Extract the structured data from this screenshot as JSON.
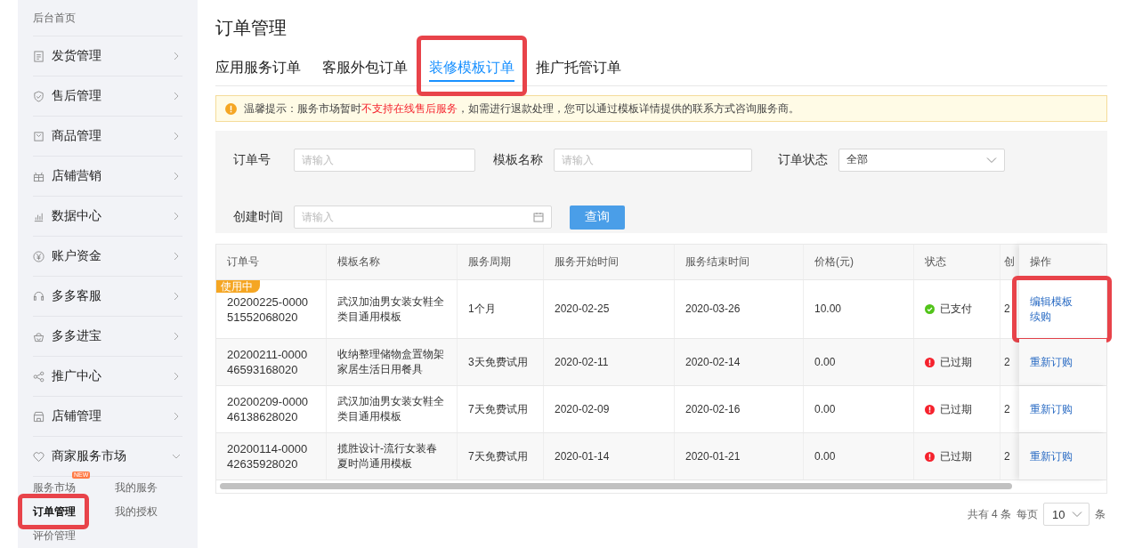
{
  "sidebar": {
    "home": "后台首页",
    "items": [
      {
        "label": "发货管理",
        "expanded": false
      },
      {
        "label": "售后管理",
        "expanded": false
      },
      {
        "label": "商品管理",
        "expanded": false
      },
      {
        "label": "店铺营销",
        "expanded": false
      },
      {
        "label": "数据中心",
        "expanded": false
      },
      {
        "label": "账户资金",
        "expanded": false
      },
      {
        "label": "多多客服",
        "expanded": false
      },
      {
        "label": "多多进宝",
        "expanded": false
      },
      {
        "label": "推广中心",
        "expanded": false
      },
      {
        "label": "店铺管理",
        "expanded": false
      },
      {
        "label": "商家服务市场",
        "expanded": true
      }
    ],
    "sub_items": [
      {
        "label": "服务市场",
        "badge": "NEW",
        "selected": false,
        "highlighted": false
      },
      {
        "label": "我的服务",
        "selected": false,
        "highlighted": false
      },
      {
        "label": "订单管理",
        "selected": true,
        "highlighted": true
      },
      {
        "label": "我的授权",
        "selected": false,
        "highlighted": false
      },
      {
        "label": "评价管理",
        "selected": false,
        "highlighted": false
      }
    ]
  },
  "page_title": "订单管理",
  "tabs": [
    {
      "label": "应用服务订单",
      "selected": false,
      "highlighted": false
    },
    {
      "label": "客服外包订单",
      "selected": false,
      "highlighted": false
    },
    {
      "label": "装修模板订单",
      "selected": true,
      "highlighted": true
    },
    {
      "label": "推广托管订单",
      "selected": false,
      "highlighted": false
    }
  ],
  "notice": {
    "text": "温馨提示：服务市场暂时**不支持在线售后服务**，如需进行退款处理，您可以通过模板详情提供的联系方式咨询服务商。"
  },
  "filters": [
    {
      "kind": "text",
      "label": "订单号",
      "placeholder": "请输入"
    },
    {
      "kind": "text",
      "label": "模板名称",
      "placeholder": "请输入"
    },
    {
      "kind": "select",
      "label": "订单状态",
      "value": "全部"
    },
    {
      "kind": "date",
      "label": "创建时间",
      "placeholder": "请输入"
    }
  ],
  "search_button": "查询",
  "table": {
    "columns": [
      "订单号",
      "模板名称",
      "服务周期",
      "服务开始时间",
      "服务结束时间",
      "价格(元)",
      "状态",
      "创",
      "操作"
    ],
    "rows": [
      {
        "tag": "使用中",
        "order_no": "20200225-000051552068020",
        "template": "武汉加油男女装女鞋全类目通用模板",
        "period": "1个月",
        "start": "2020-02-25",
        "end": "2020-03-26",
        "price": "10.00",
        "status": {
          "kind": "paid",
          "label": "已支付"
        },
        "created": "2",
        "actions": [
          "编辑模板",
          "续购"
        ],
        "highlighted": true
      },
      {
        "order_no": "20200211-000046593168020",
        "template": "收纳整理储物盒置物架家居生活日用餐具",
        "period": "3天免费试用",
        "start": "2020-02-11",
        "end": "2020-02-14",
        "price": "0.00",
        "status": {
          "kind": "expired",
          "label": "已过期"
        },
        "created": "2",
        "actions": [
          "重新订购"
        ],
        "highlighted": false
      },
      {
        "order_no": "20200209-000046138628020",
        "template": "武汉加油男女装女鞋全类目通用模板",
        "period": "7天免费试用",
        "start": "2020-02-09",
        "end": "2020-02-16",
        "price": "0.00",
        "status": {
          "kind": "expired",
          "label": "已过期"
        },
        "created": "2",
        "actions": [
          "重新订购"
        ],
        "highlighted": false
      },
      {
        "order_no": "20200114-000042635928020",
        "template": "揽胜设计-流行女装春夏时尚通用模板",
        "period": "7天免费试用",
        "start": "2020-01-14",
        "end": "2020-01-21",
        "price": "0.00",
        "status": {
          "kind": "expired",
          "label": "已过期"
        },
        "created": "2",
        "actions": [
          "重新订购"
        ],
        "highlighted": false
      }
    ]
  },
  "pagination": {
    "total": "共有 4 条",
    "per_page_label": "每页",
    "per_page": "10",
    "unit": "条"
  }
}
